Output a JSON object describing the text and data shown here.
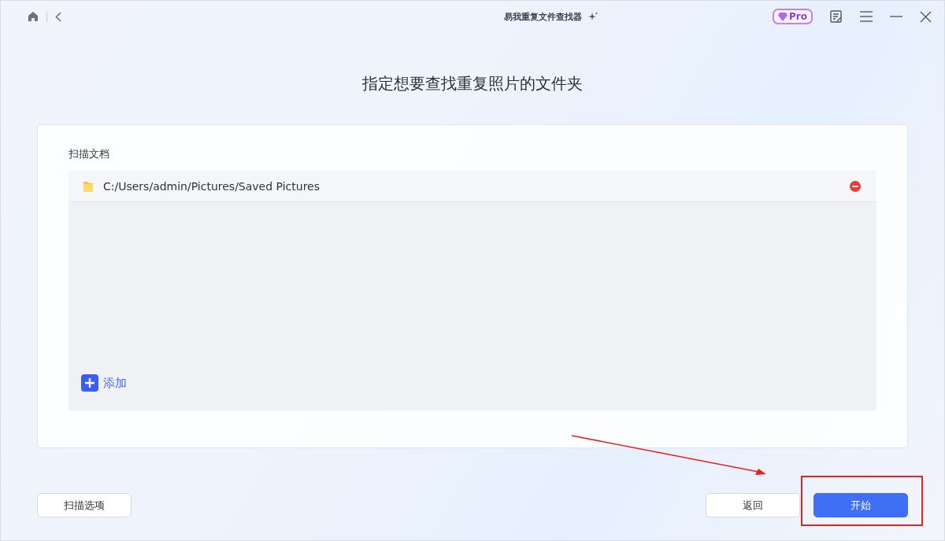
{
  "window": {
    "title": "易我重复文件查找器",
    "badge": "Pro"
  },
  "heading": "指定想要查找重复照片的文件夹",
  "section_label": "扫描文档",
  "folders": [
    {
      "path": "C:/Users/admin/Pictures/Saved Pictures"
    }
  ],
  "add_label": "添加",
  "buttons": [
    {
      "label": "扫描选项",
      "kind": "outline"
    },
    {
      "label": "返回",
      "kind": "outline"
    },
    {
      "label": "开始",
      "kind": "primary"
    }
  ]
}
